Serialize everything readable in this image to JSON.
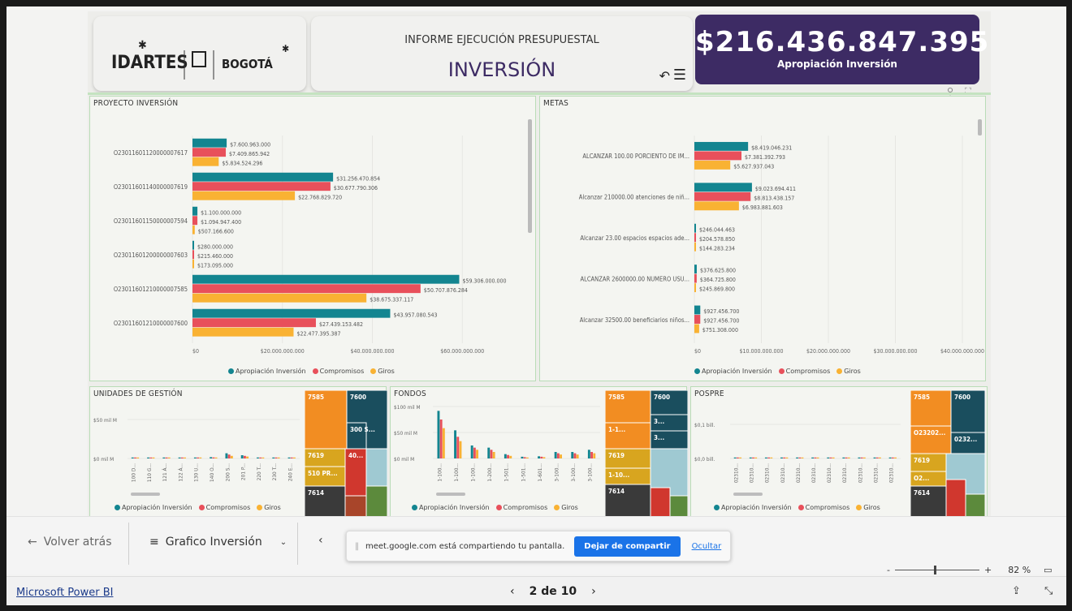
{
  "header": {
    "logos": [
      "IDARTES",
      "BOGOTÁ"
    ],
    "title_top": "INFORME EJECUCIÓN PRESUPUESTAL",
    "title_main": "INVERSIÓN",
    "kpi_value": "$216.436.847.395",
    "kpi_label": "Apropiación Inversión"
  },
  "panels": {
    "proyecto": "PROYECTO INVERSIÓN",
    "metas": "METAS",
    "unidades": "UNIDADES DE GESTIÓN",
    "fondos": "FONDOS",
    "pospre": "POSPRE"
  },
  "legend": {
    "apropiacion": "Apropiación Inversión",
    "compromisos": "Compromisos",
    "giros": "Giros"
  },
  "colors": {
    "apropiacion": "#138590",
    "compromisos": "#e8505b",
    "giros": "#f9b233",
    "kpi_bg": "#3d2b64"
  },
  "chart_data": [
    {
      "type": "bar",
      "orientation": "horizontal",
      "title": "PROYECTO INVERSIÓN",
      "categories": [
        "O2301160112000000761​7",
        "O23011601140000007619",
        "O23011601150000007594",
        "O23011601200000007603",
        "O23011601210000007585",
        "O23011601210000007600"
      ],
      "series": [
        {
          "name": "Apropiación Inversión",
          "values": [
            7600963000,
            31256470854,
            1100000000,
            280000000,
            59306000000,
            43957080543
          ],
          "labels": [
            "$7.600.963.000",
            "$31.256.470.854",
            "$1.100.000.000",
            "$280.000.000",
            "$59.306.000.000",
            "$43.957.080.543"
          ]
        },
        {
          "name": "Compromisos",
          "values": [
            7409865942,
            30677790306,
            1094947400,
            215460000,
            50707876284,
            27439153482
          ],
          "labels": [
            "$7.409.865.942",
            "$30.677.790.306",
            "$1.094.947.400",
            "$215.460.000",
            "$50.707.876.284",
            "$27.439.153.482"
          ]
        },
        {
          "name": "Giros",
          "values": [
            5834524296,
            22768829720,
            507166600,
            173095000,
            38675337117,
            22477395387
          ],
          "labels": [
            "$5.834.524.296",
            "$22.768.829.720",
            "$507.166.600",
            "$173.095.000",
            "$38.675.337.117",
            "$22.477.395.387"
          ]
        }
      ],
      "xticks": [
        "$0",
        "$20.000.000.000",
        "$40.000.000.000",
        "$60.000.000.000"
      ],
      "xlim": [
        0,
        65000000000
      ]
    },
    {
      "type": "bar",
      "orientation": "horizontal",
      "title": "METAS",
      "categories": [
        "ALCANZAR 100.00 PORCIENTO DE IM...",
        "Alcanzar 210000.00 atenciones de niñ...",
        "Alcanzar 23.00 espacios espacios ade...",
        "ALCANZAR 2600000.00 NUMERO USU...",
        "Alcanzar 32500.00 beneficiarios niños..."
      ],
      "series": [
        {
          "name": "Apropiación Inversión",
          "values": [
            8419046231,
            9023694411,
            246044463,
            376625800,
            927456700
          ],
          "labels": [
            "$8.419.046.231",
            "$9.023.694.411",
            "$246.044.463",
            "$376.625.800",
            "$927.456.700"
          ]
        },
        {
          "name": "Compromisos",
          "values": [
            7381392793,
            8813438157,
            204578850,
            364725800,
            927456700
          ],
          "labels": [
            "$7.381.392.793",
            "$8.813.438.157",
            "$204.578.850",
            "$364.725.800",
            "$927.456.700"
          ]
        },
        {
          "name": "Giros",
          "values": [
            5627937043,
            6983881603,
            144283234,
            245869800,
            751308000
          ],
          "labels": [
            "$5.627.937.043",
            "$6.983.881.603",
            "$144.283.234",
            "$245.869.800",
            "$751.308.000"
          ]
        }
      ],
      "xticks": [
        "$0",
        "$10.000.000.000",
        "$20.000.000.000",
        "$30.000.000.000",
        "$40.000.000.000"
      ],
      "xlim": [
        0,
        42000000000
      ]
    },
    {
      "type": "bar",
      "title": "UNIDADES DE GESTIÓN",
      "categories": [
        "100 D...",
        "110 G...",
        "121 Á...",
        "122 Á...",
        "130 U...",
        "140 O...",
        "200 S...",
        "201 P...",
        "220 T...",
        "230 T...",
        "240 E..."
      ],
      "series": [
        {
          "name": "Apropiación Inversión",
          "values": [
            1,
            1,
            1,
            1,
            1.5,
            2,
            8,
            5,
            1,
            1,
            1
          ]
        },
        {
          "name": "Compromisos",
          "values": [
            0.8,
            0.8,
            0.8,
            0.8,
            1.2,
            1.6,
            6,
            4,
            0.8,
            0.8,
            0.8
          ]
        },
        {
          "name": "Giros",
          "values": [
            0.6,
            0.6,
            0.6,
            0.6,
            1,
            1.2,
            4,
            3,
            0.6,
            0.6,
            0.6
          ]
        }
      ],
      "yticks": [
        "$50 mil M",
        "$0 mil M"
      ],
      "ylim": [
        0,
        60
      ],
      "treemap": [
        "7585",
        "7600",
        "300 S...",
        "7619",
        "510 PR...",
        "7614",
        "40..."
      ]
    },
    {
      "type": "bar",
      "title": "FONDOS",
      "categories": [
        "1-100...",
        "1-100...",
        "1-100...",
        "1-200...",
        "1-501...",
        "1-501...",
        "1-601...",
        "3-100...",
        "3-100...",
        "3-100..."
      ],
      "series": [
        {
          "name": "Apropiación Inversión",
          "values": [
            110,
            65,
            30,
            25,
            10,
            4,
            5,
            15,
            15,
            20
          ]
        },
        {
          "name": "Compromisos",
          "values": [
            90,
            50,
            25,
            20,
            8,
            3,
            4,
            12,
            12,
            15
          ]
        },
        {
          "name": "Giros",
          "values": [
            70,
            40,
            20,
            15,
            6,
            2,
            3,
            9,
            9,
            12
          ]
        }
      ],
      "yticks": [
        "$100 mil M",
        "$50 mil M",
        "$0 mil M"
      ],
      "ylim": [
        0,
        120
      ],
      "treemap": [
        "7585",
        "7600",
        "1-1...",
        "3...",
        "3...",
        "7619",
        "1-10...",
        "7614"
      ]
    },
    {
      "type": "bar",
      "title": "POSPRE",
      "categories": [
        "02310...",
        "02310...",
        "02310...",
        "02310...",
        "02310...",
        "02310...",
        "02310...",
        "02310...",
        "02310...",
        "02310...",
        "02310..."
      ],
      "series": [
        {
          "name": "Apropiación Inversión",
          "values": [
            1,
            1,
            1,
            1,
            1,
            1,
            1,
            1,
            1,
            1,
            1
          ]
        },
        {
          "name": "Compromisos",
          "values": [
            0.8,
            0.8,
            0.8,
            0.8,
            0.8,
            0.8,
            0.8,
            0.8,
            0.8,
            0.8,
            0.8
          ]
        },
        {
          "name": "Giros",
          "values": [
            0.6,
            0.6,
            0.6,
            0.6,
            0.6,
            0.6,
            0.6,
            0.6,
            0.6,
            0.6,
            0.6
          ]
        }
      ],
      "yticks": [
        "$0,1 bill.",
        "$0,0 bill."
      ],
      "ylim": [
        0,
        150
      ],
      "treemap": [
        "7585",
        "7600",
        "O23202...",
        "0232...",
        "7619",
        "O2...",
        "7614"
      ]
    }
  ],
  "bottom": {
    "back": "Volver atrás",
    "page_menu": "Grafico Inversión",
    "share_text": "meet.google.com está compartiendo tu pantalla.",
    "stop_share": "Dejar de compartir",
    "hide": "Ocultar",
    "zoom": "82 %",
    "brand": "Microsoft Power BI",
    "page_indicator": "2 de 10"
  }
}
